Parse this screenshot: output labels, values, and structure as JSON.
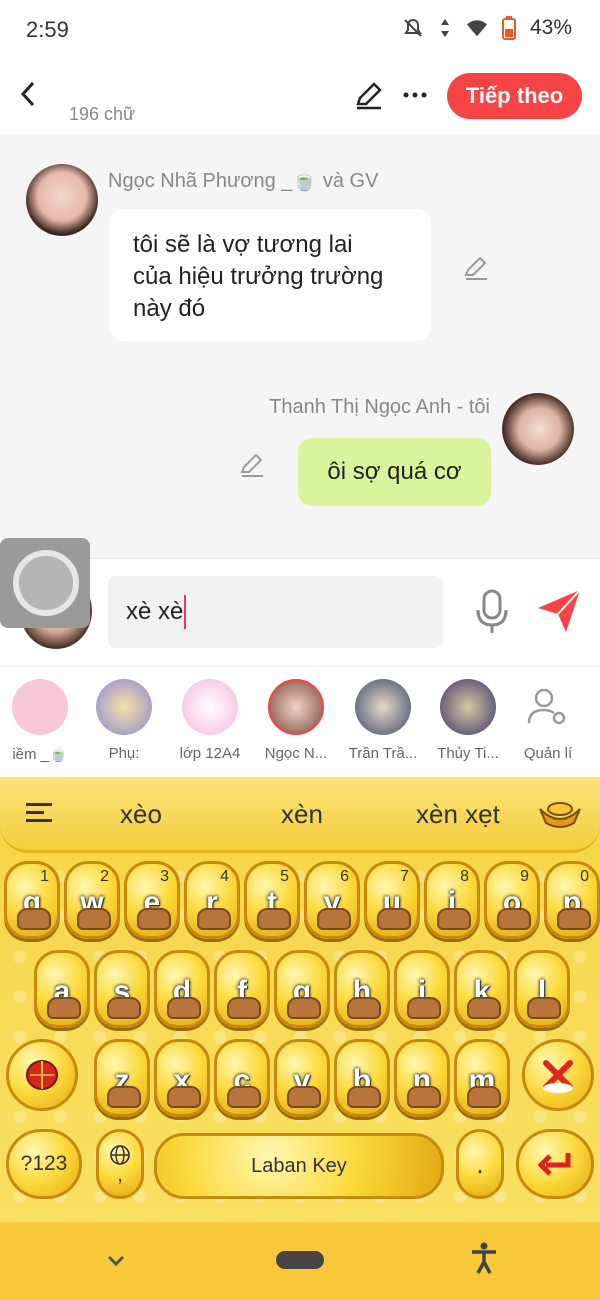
{
  "status": {
    "time": "2:59",
    "battery": "43%",
    "net_badge": "4"
  },
  "header": {
    "word_count": "196 chữ",
    "next_label": "Tiếp theo"
  },
  "chat": {
    "messages": [
      {
        "sender": "Ngọc Nhã Phương _🍵 và GV",
        "text_lines": [
          "tôi sẽ là vợ tương lai",
          "của hiệu trưởng trường",
          "này đó"
        ]
      },
      {
        "sender": "Thanh Thị Ngọc Anh - tôi",
        "text": "ôi sợ quá cơ"
      }
    ]
  },
  "input": {
    "value": "xè xè"
  },
  "contacts": [
    {
      "label": "iềm _🍵",
      "color": "#f7c8d6"
    },
    {
      "label": "Phụ:",
      "color": "#c9c7f0"
    },
    {
      "label": "lớp 12A4",
      "color": "#f5b6dc"
    },
    {
      "label": "Ngọc N...",
      "color": "#e8b6a6"
    },
    {
      "label": "Trần Trầ...",
      "color": "#9ab0cc"
    },
    {
      "label": "Thủy Ti...",
      "color": "#7c6fa8"
    },
    {
      "label": "Quản lí",
      "color": "#ffffff"
    }
  ],
  "keyboard": {
    "suggestions": [
      "xèo",
      "xèn",
      "xèn xẹt"
    ],
    "row1": [
      {
        "ch": "q",
        "num": "1"
      },
      {
        "ch": "w",
        "num": "2"
      },
      {
        "ch": "e",
        "num": "3"
      },
      {
        "ch": "r",
        "num": "4"
      },
      {
        "ch": "t",
        "num": "5"
      },
      {
        "ch": "y",
        "num": "6"
      },
      {
        "ch": "u",
        "num": "7"
      },
      {
        "ch": "i",
        "num": "8"
      },
      {
        "ch": "o",
        "num": "9"
      },
      {
        "ch": "p",
        "num": "0"
      }
    ],
    "row2": [
      "a",
      "s",
      "d",
      "f",
      "g",
      "h",
      "j",
      "k",
      "l"
    ],
    "row3": [
      "z",
      "x",
      "c",
      "v",
      "b",
      "n",
      "m"
    ],
    "symbols_label": "?123",
    "comma_label": ",",
    "space_label": "Laban Key",
    "period_label": "."
  },
  "colors": {
    "accent": "#f64345",
    "own_bubble": "#d9f49a",
    "keyboard_bg": "#f8d94c"
  }
}
